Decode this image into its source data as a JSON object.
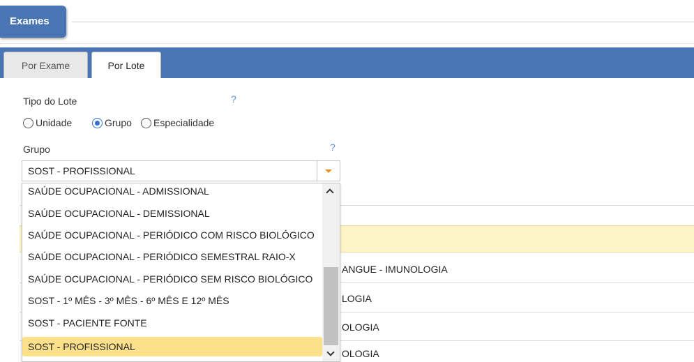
{
  "section": {
    "title": "Exames"
  },
  "tabs": [
    {
      "label": "Por Exame",
      "active": false
    },
    {
      "label": "Por Lote",
      "active": true
    }
  ],
  "tipo_lote": {
    "label": "Tipo do Lote",
    "help": "?",
    "options": [
      {
        "label": "Unidade",
        "checked": false
      },
      {
        "label": "Grupo",
        "checked": true
      },
      {
        "label": "Especialidade",
        "checked": false
      }
    ]
  },
  "grupo": {
    "label": "Grupo",
    "help": "?",
    "selected_value": "SOST - PROFISSIONAL",
    "options": [
      "SAÚDE OCUPACIONAL - ADMISSIONAL",
      "SAÚDE OCUPACIONAL - DEMISSIONAL",
      "SAÚDE OCUPACIONAL - PERIÓDICO COM RISCO BIOLÓGICO",
      "SAÚDE OCUPACIONAL - PERIÓDICO SEMESTRAL RAIO-X",
      "SAÚDE OCUPACIONAL - PERIÓDICO SEM RISCO BIOLÓGICO",
      "SOST - 1º MÊS - 3º MÊS - 6º MÊS E 12º MÊS",
      "SOST - PACIENTE FONTE",
      "SOST - PROFISSIONAL"
    ],
    "selected_index": 7
  },
  "background_rows": [
    "ANGUE - IMUNOLOGIA",
    "LOGIA",
    "OLOGIA",
    "OLOGIA"
  ],
  "colors": {
    "accent": "#4a75b5",
    "selected": "#fde08a",
    "highlight": "#fdf4c8"
  }
}
